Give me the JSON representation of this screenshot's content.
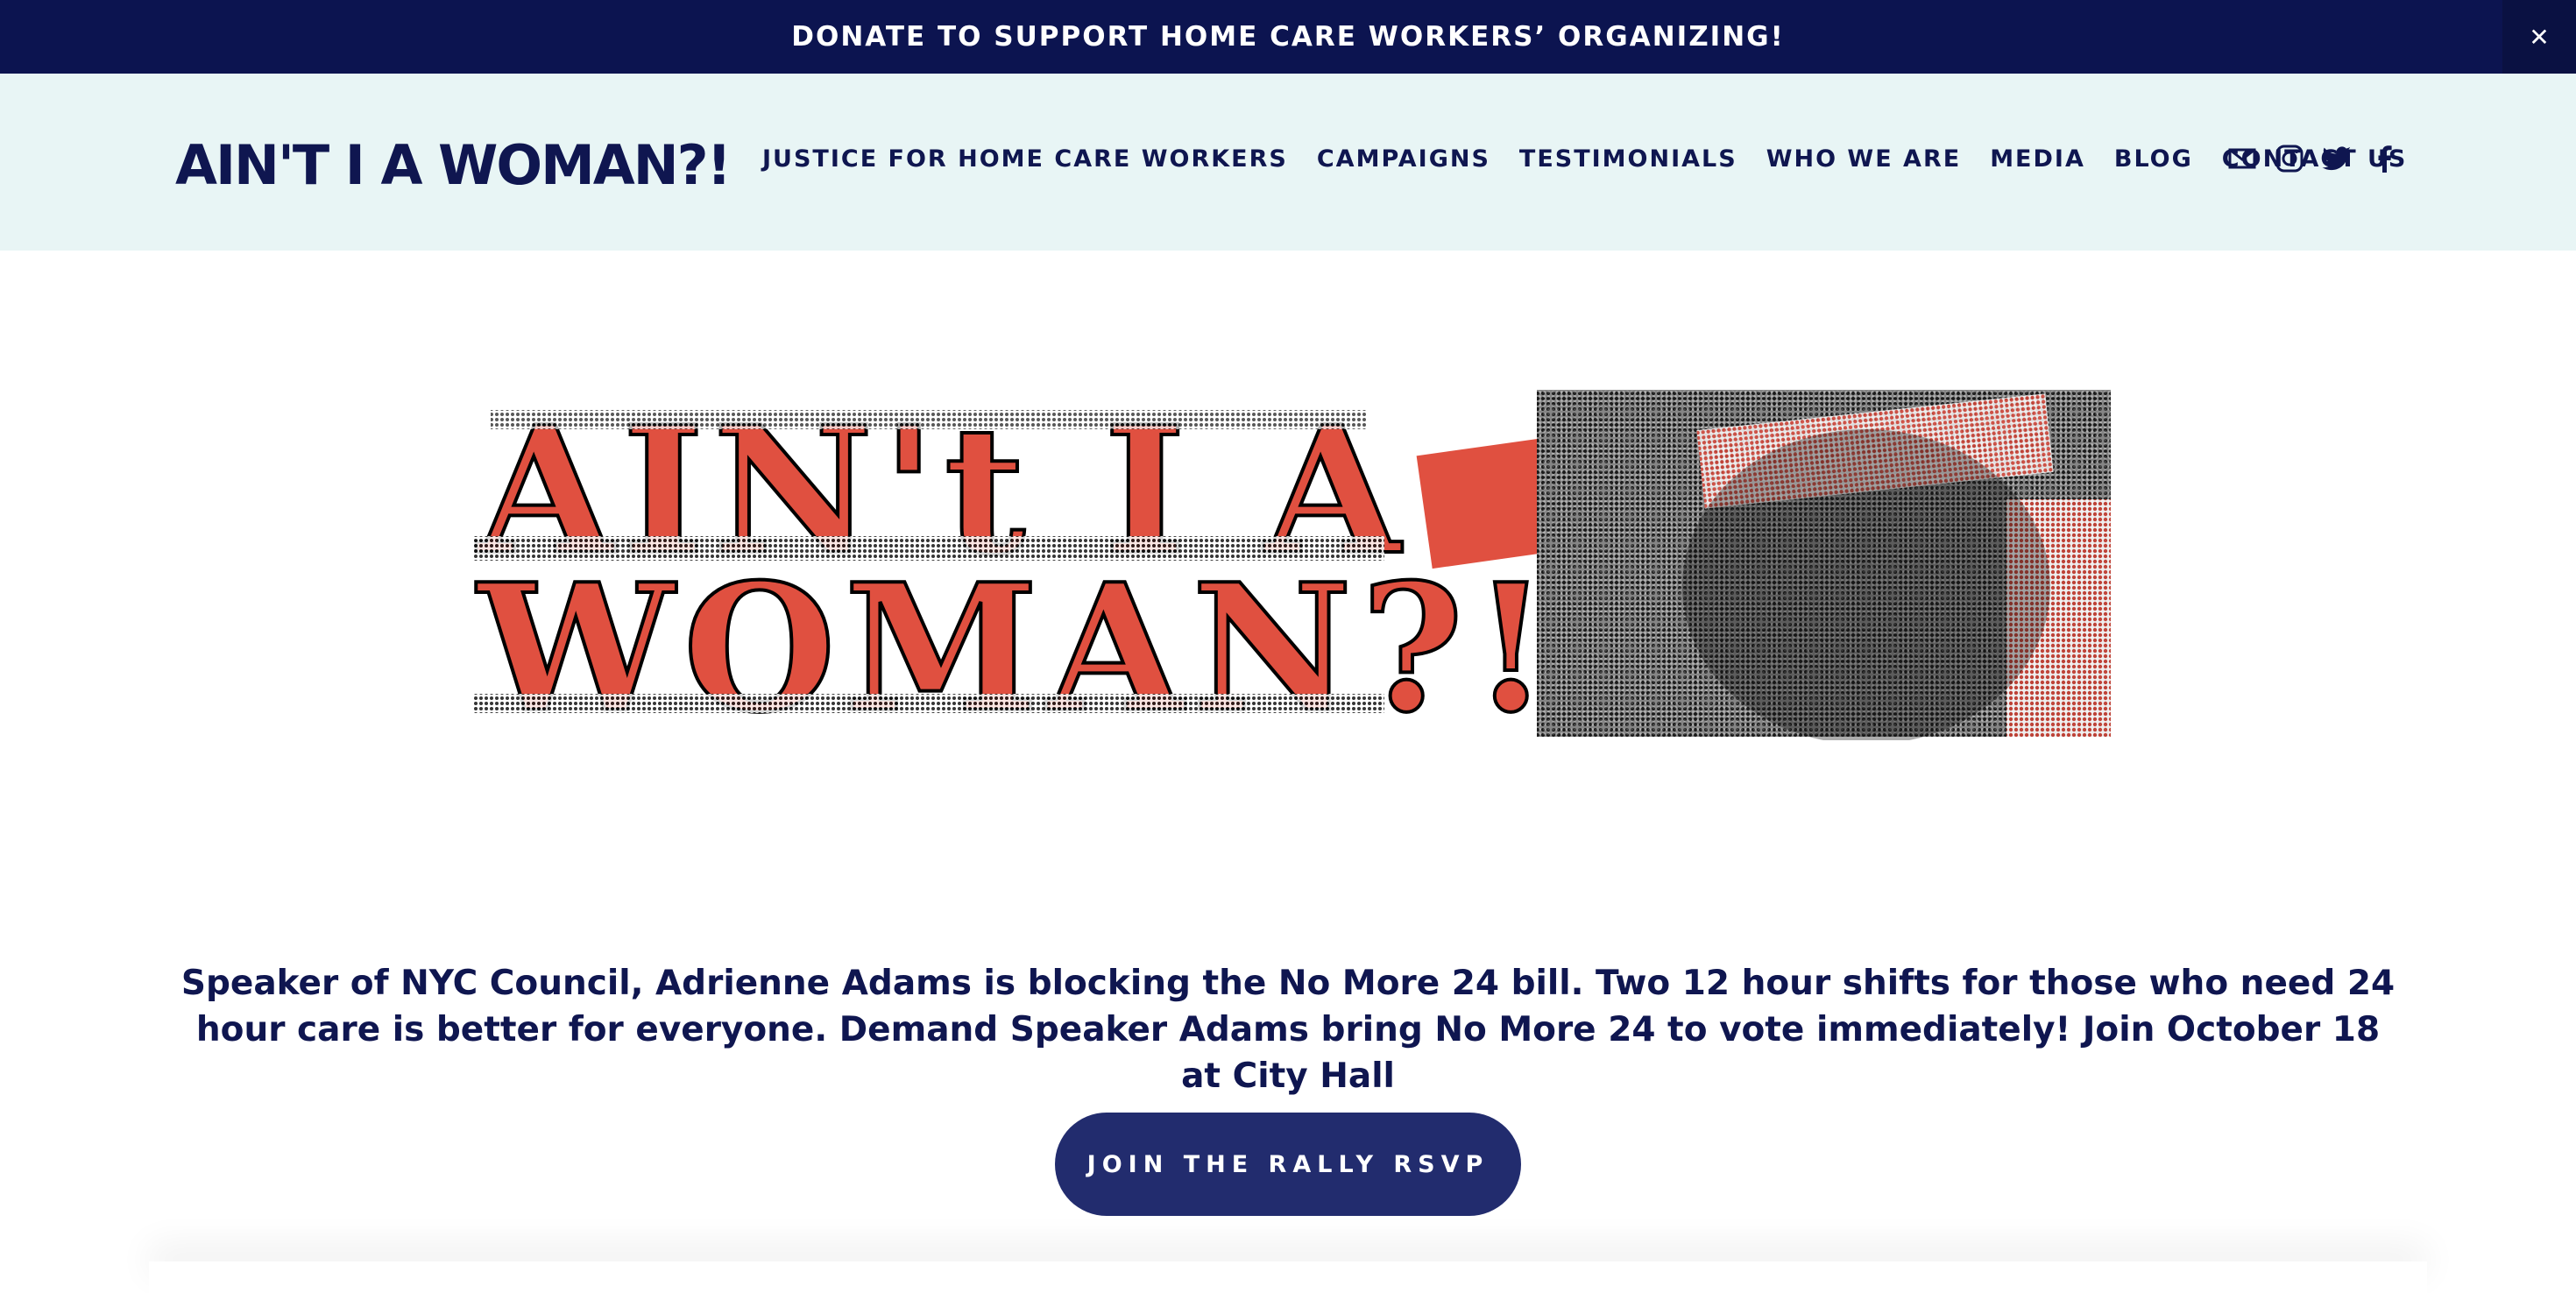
{
  "announcement": {
    "text": "DONATE TO SUPPORT HOME CARE WORKERS’ ORGANIZING!",
    "close_icon": "close-icon"
  },
  "header": {
    "logo": "AIN'T I A WOMAN?!",
    "nav": [
      "JUSTICE FOR HOME CARE WORKERS",
      "CAMPAIGNS",
      "TESTIMONIALS",
      "WHO WE ARE",
      "MEDIA",
      "BLOG",
      "CONTACT US"
    ],
    "social_icons": [
      "email-icon",
      "instagram-icon",
      "twitter-icon",
      "facebook-icon"
    ]
  },
  "hero": {
    "banner_line1": "AIN't I A",
    "banner_line2": "WOMAN?!"
  },
  "message": "Speaker of NYC Council, Adrienne Adams is blocking the No More 24 bill. Two 12 hour shifts for those who need 24 hour care is better for everyone. Demand Speaker Adams bring No More 24 to vote immediately! Join October 18 at City Hall",
  "cta": {
    "label": "JOIN THE RALLY RSVP"
  },
  "colors": {
    "navy": "#0c1450",
    "header_bg": "#e8f5f5",
    "accent_red": "#e05040",
    "button": "#222c6e"
  }
}
